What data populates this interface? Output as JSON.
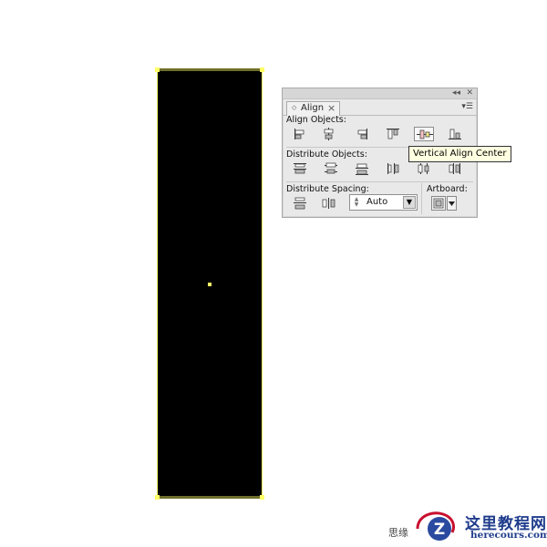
{
  "panel": {
    "tab_label": "Align",
    "align_objects_label": "Align Objects:",
    "distribute_objects_label": "Distribute Objects:",
    "distribute_spacing_label": "Distribute Spacing:",
    "artboard_label": "Artboard:",
    "spacing_value": "Auto",
    "align_buttons": [
      "horizontal-align-left",
      "horizontal-align-center",
      "horizontal-align-right",
      "vertical-align-top",
      "vertical-align-center",
      "vertical-align-bottom"
    ],
    "distribute_buttons": [
      "vertical-distribute-top",
      "vertical-distribute-center",
      "vertical-distribute-bottom",
      "horizontal-distribute-left",
      "horizontal-distribute-center",
      "horizontal-distribute-right"
    ],
    "spacing_buttons": [
      "vertical-distribute-space",
      "horizontal-distribute-space"
    ]
  },
  "tooltip": {
    "text": "Vertical Align Center"
  },
  "watermark": {
    "small_text": "思缘",
    "title": "这里教程网",
    "url": "herecours.com"
  },
  "colors": {
    "selection": "#ffff66",
    "watermark_blue": "#1f3c8c",
    "watermark_red": "#c8102e"
  }
}
